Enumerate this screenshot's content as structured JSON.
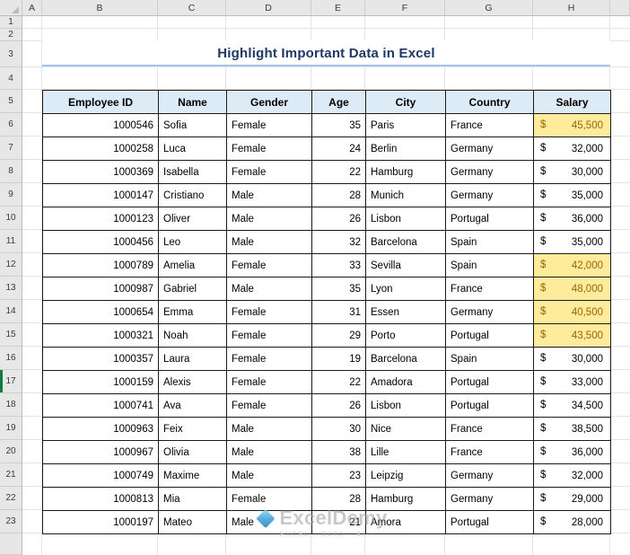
{
  "sheet": {
    "column_headers": [
      "A",
      "B",
      "C",
      "D",
      "E",
      "F",
      "G",
      "H"
    ],
    "row_headers": [
      "1",
      "2",
      "3",
      "4",
      "5",
      "6",
      "7",
      "8",
      "9",
      "10",
      "11",
      "12",
      "13",
      "14",
      "15",
      "16",
      "17",
      "18",
      "19",
      "20",
      "21",
      "22",
      "23"
    ],
    "active_row_header": "17"
  },
  "title": "Highlight Important Data in Excel",
  "table": {
    "headers": [
      "Employee ID",
      "Name",
      "Gender",
      "Age",
      "City",
      "Country",
      "Salary"
    ],
    "currency_symbol": "$",
    "rows": [
      {
        "id": "1000546",
        "name": "Sofia",
        "gender": "Female",
        "age": "35",
        "city": "Paris",
        "country": "France",
        "salary": "45,500",
        "highlight": true
      },
      {
        "id": "1000258",
        "name": "Luca",
        "gender": "Female",
        "age": "24",
        "city": "Berlin",
        "country": "Germany",
        "salary": "32,000",
        "highlight": false
      },
      {
        "id": "1000369",
        "name": "Isabella",
        "gender": "Female",
        "age": "22",
        "city": "Hamburg",
        "country": "Germany",
        "salary": "30,000",
        "highlight": false
      },
      {
        "id": "1000147",
        "name": "Cristiano",
        "gender": "Male",
        "age": "28",
        "city": "Munich",
        "country": "Germany",
        "salary": "35,000",
        "highlight": false
      },
      {
        "id": "1000123",
        "name": "Oliver",
        "gender": "Male",
        "age": "26",
        "city": "Lisbon",
        "country": "Portugal",
        "salary": "36,000",
        "highlight": false
      },
      {
        "id": "1000456",
        "name": "Leo",
        "gender": "Male",
        "age": "32",
        "city": "Barcelona",
        "country": "Spain",
        "salary": "35,000",
        "highlight": false
      },
      {
        "id": "1000789",
        "name": "Amelia",
        "gender": "Female",
        "age": "33",
        "city": "Sevilla",
        "country": "Spain",
        "salary": "42,000",
        "highlight": true
      },
      {
        "id": "1000987",
        "name": "Gabriel",
        "gender": "Male",
        "age": "35",
        "city": "Lyon",
        "country": "France",
        "salary": "48,000",
        "highlight": true
      },
      {
        "id": "1000654",
        "name": "Emma",
        "gender": "Female",
        "age": "31",
        "city": "Essen",
        "country": "Germany",
        "salary": "40,500",
        "highlight": true
      },
      {
        "id": "1000321",
        "name": "Noah",
        "gender": "Female",
        "age": "29",
        "city": "Porto",
        "country": "Portugal",
        "salary": "43,500",
        "highlight": true
      },
      {
        "id": "1000357",
        "name": "Laura",
        "gender": "Female",
        "age": "19",
        "city": "Barcelona",
        "country": "Spain",
        "salary": "30,000",
        "highlight": false
      },
      {
        "id": "1000159",
        "name": "Alexis",
        "gender": "Female",
        "age": "22",
        "city": "Amadora",
        "country": "Portugal",
        "salary": "33,000",
        "highlight": false
      },
      {
        "id": "1000741",
        "name": "Ava",
        "gender": "Female",
        "age": "26",
        "city": "Lisbon",
        "country": "Portugal",
        "salary": "34,500",
        "highlight": false
      },
      {
        "id": "1000963",
        "name": "Feix",
        "gender": "Male",
        "age": "30",
        "city": "Nice",
        "country": "France",
        "salary": "38,500",
        "highlight": false
      },
      {
        "id": "1000967",
        "name": "Olivia",
        "gender": "Male",
        "age": "38",
        "city": "Lille",
        "country": "France",
        "salary": "36,000",
        "highlight": false
      },
      {
        "id": "1000749",
        "name": "Maxime",
        "gender": "Male",
        "age": "23",
        "city": "Leipzig",
        "country": "Germany",
        "salary": "32,000",
        "highlight": false
      },
      {
        "id": "1000813",
        "name": "Mia",
        "gender": "Female",
        "age": "28",
        "city": "Hamburg",
        "country": "Germany",
        "salary": "29,000",
        "highlight": false
      },
      {
        "id": "1000197",
        "name": "Mateo",
        "gender": "Male",
        "age": "21",
        "city": "Amora",
        "country": "Portugal",
        "salary": "28,000",
        "highlight": false
      }
    ]
  },
  "watermark": {
    "brand": "ExcelDemy",
    "tagline": "EXCEL · DATA · BI"
  },
  "colors": {
    "title_text": "#1F3864",
    "title_underline": "#9DC3E6",
    "table_header_bg": "#DDEBF7",
    "highlight_bg": "#FFEB9C",
    "highlight_text": "#9C6500",
    "active_row_accent": "#107C41",
    "watermark_blue": "#2E9BD6"
  }
}
